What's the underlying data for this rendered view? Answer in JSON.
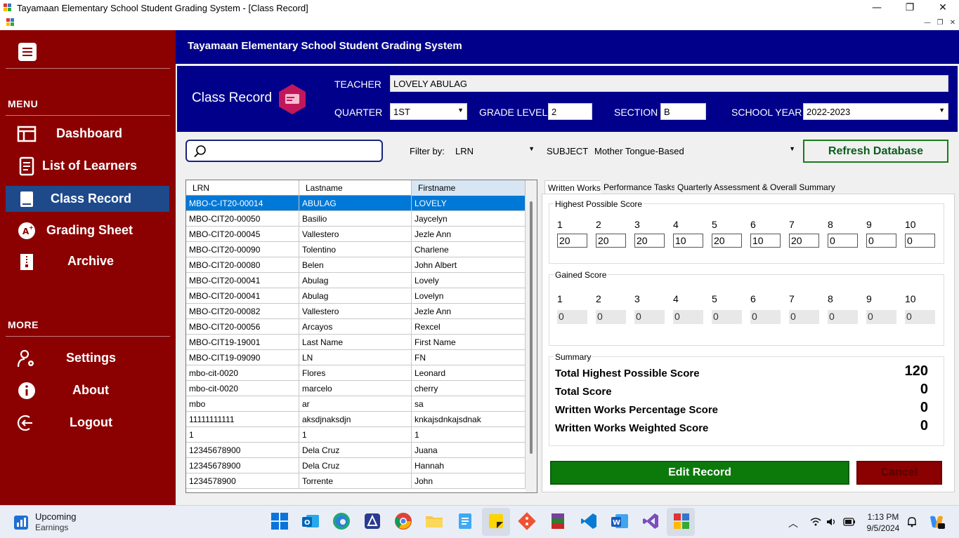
{
  "window": {
    "title": "Tayamaan Elementary School Student Grading System - [Class Record]"
  },
  "sidebar": {
    "menu_label": "MENU",
    "more_label": "MORE",
    "items": [
      {
        "label": "Dashboard"
      },
      {
        "label": "List of Learners"
      },
      {
        "label": "Class Record"
      },
      {
        "label": "Grading Sheet"
      },
      {
        "label": "Archive"
      }
    ],
    "more_items": [
      {
        "label": "Settings"
      },
      {
        "label": "About"
      },
      {
        "label": "Logout"
      }
    ]
  },
  "header": {
    "title": "Tayamaan Elementary School Student Grading System"
  },
  "info": {
    "page_title": "Class Record",
    "teacher_label": "TEACHER",
    "teacher_value": "LOVELY ABULAG",
    "quarter_label": "QUARTER",
    "quarter_value": "1ST",
    "grade_label": "GRADE LEVEL",
    "grade_value": "2",
    "section_label": "SECTION",
    "section_value": "B",
    "year_label": "SCHOOL YEAR",
    "year_value": "2022-2023"
  },
  "filters": {
    "search_value": "",
    "filter_label": "Filter by:",
    "filter_value": "LRN",
    "subject_label": "SUBJECT",
    "subject_value": "Mother Tongue-Based",
    "refresh_label": "Refresh Database"
  },
  "table": {
    "columns": [
      "LRN",
      "Lastname",
      "Firstname"
    ],
    "rows": [
      [
        "MBO-C-IT20-00014",
        "ABULAG",
        "LOVELY"
      ],
      [
        "MBO-CIT20-00050",
        "Basilio",
        "Jaycelyn"
      ],
      [
        "MBO-CIT20-00045",
        "Vallestero",
        "Jezle Ann"
      ],
      [
        "MBO-CIT20-00090",
        "Tolentino",
        "Charlene"
      ],
      [
        "MBO-CIT20-00080",
        "Belen",
        "John Albert"
      ],
      [
        "MBO-CIT20-00041",
        "Abulag",
        "Lovely"
      ],
      [
        "MBO-CIT20-00041",
        "Abulag",
        "Lovelyn"
      ],
      [
        "MBO-CIT20-00082",
        "Vallestero",
        "Jezle Ann"
      ],
      [
        "MBO-CIT20-00056",
        "Arcayos",
        "Rexcel"
      ],
      [
        "MBO-CIT19-19001",
        "Last Name",
        "First Name"
      ],
      [
        "MBO-CIT19-09090",
        "LN",
        "FN"
      ],
      [
        "mbo-cit-0020",
        "Flores",
        "Leonard"
      ],
      [
        "mbo-cit-0020",
        "marcelo",
        "cherry"
      ],
      [
        "mbo",
        "ar",
        "sa"
      ],
      [
        "11111111111",
        "aksdjnaksdjn",
        "knkajsdnkajsdnak"
      ],
      [
        "1",
        "1",
        "1"
      ],
      [
        "12345678900",
        "Dela Cruz",
        "Juana"
      ],
      [
        "12345678900",
        "Dela Cruz",
        "Hannah"
      ],
      [
        "1234578900",
        "Torrente",
        "John"
      ]
    ]
  },
  "tabs": [
    "Written Works",
    "Performance Tasks",
    "Quarterly Assessment & Overall Summary"
  ],
  "hps": {
    "title": "Highest Possible Score",
    "numbers": [
      "1",
      "2",
      "3",
      "4",
      "5",
      "6",
      "7",
      "8",
      "9",
      "10"
    ],
    "values": [
      "20",
      "20",
      "20",
      "10",
      "20",
      "10",
      "20",
      "0",
      "0",
      "0"
    ]
  },
  "gained": {
    "title": "Gained Score",
    "numbers": [
      "1",
      "2",
      "3",
      "4",
      "5",
      "6",
      "7",
      "8",
      "9",
      "10"
    ],
    "values": [
      "0",
      "0",
      "0",
      "0",
      "0",
      "0",
      "0",
      "0",
      "0",
      "0"
    ]
  },
  "summary": {
    "title": "Summary",
    "total_hps_label": "Total Highest Possible Score",
    "total_hps_value": "120",
    "total_score_label": "Total Score",
    "total_score_value": "0",
    "percentage_label": "Written Works Percentage Score",
    "percentage_value": "0",
    "weighted_label": "Written Works Weighted Score",
    "weighted_value": "0"
  },
  "buttons": {
    "edit": "Edit Record",
    "cancel": "Cancel"
  },
  "taskbar": {
    "weather_title": "Upcoming",
    "weather_sub": "Earnings",
    "time": "1:13 PM",
    "date": "9/5/2024"
  }
}
